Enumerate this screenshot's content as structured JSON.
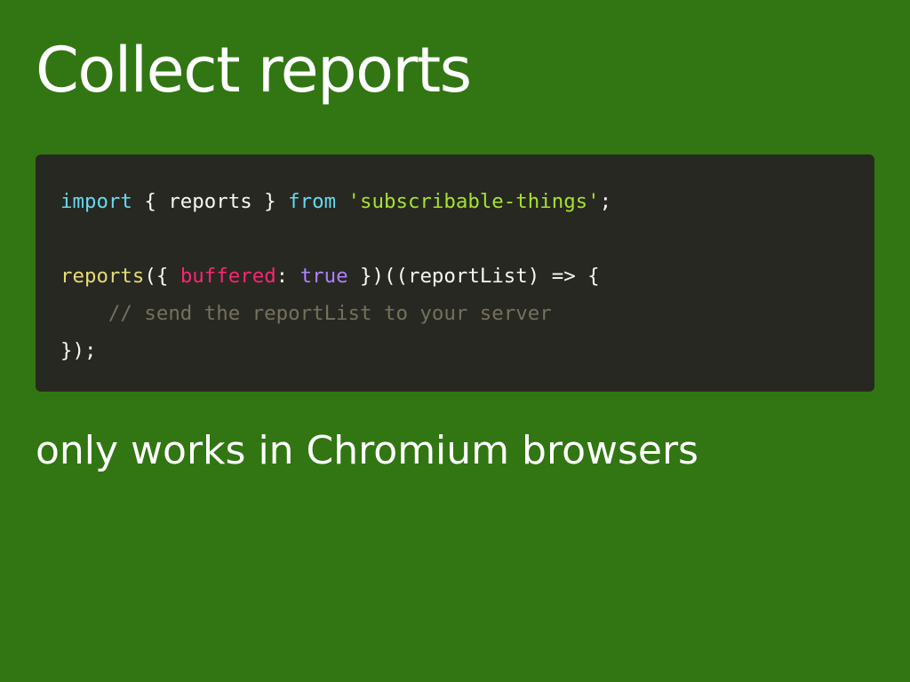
{
  "slide": {
    "title": "Collect reports",
    "subtitle": "only works in Chromium browsers",
    "background_color": "#317612"
  },
  "code": {
    "background_color": "#272822",
    "language": "javascript",
    "lines": [
      {
        "tokens": [
          {
            "type": "keyword",
            "text": "import"
          },
          {
            "type": "plain",
            "text": " { reports } "
          },
          {
            "type": "keyword",
            "text": "from"
          },
          {
            "type": "plain",
            "text": " "
          },
          {
            "type": "string",
            "text": "'subscribable-things'"
          },
          {
            "type": "plain",
            "text": ";"
          }
        ]
      },
      {
        "tokens": []
      },
      {
        "tokens": [
          {
            "type": "func",
            "text": "reports"
          },
          {
            "type": "plain",
            "text": "({ "
          },
          {
            "type": "prop",
            "text": "buffered"
          },
          {
            "type": "plain",
            "text": ": "
          },
          {
            "type": "bool",
            "text": "true"
          },
          {
            "type": "plain",
            "text": " })((reportList) => {"
          }
        ]
      },
      {
        "tokens": [
          {
            "type": "plain",
            "text": "    "
          },
          {
            "type": "comment",
            "text": "// send the reportList to your server"
          }
        ]
      },
      {
        "tokens": [
          {
            "type": "plain",
            "text": "});"
          }
        ]
      }
    ]
  }
}
